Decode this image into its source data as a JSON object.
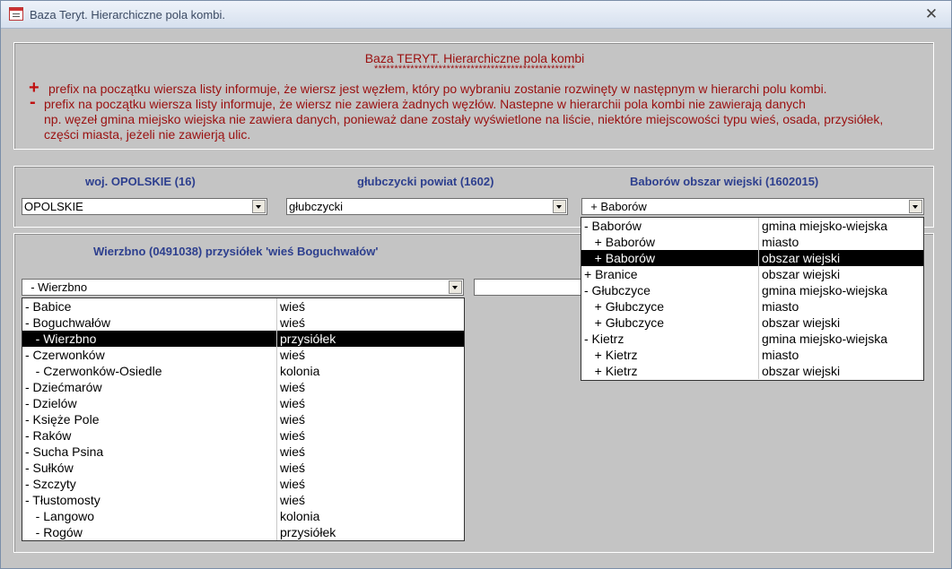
{
  "window": {
    "title": "Baza Teryt. Hierarchiczne pola kombi.",
    "close_glyph": "✕"
  },
  "info": {
    "title": "Baza TERYT. Hierarchiczne pola kombi",
    "stars": "**************************************************",
    "plus_symbol": "+",
    "minus_symbol": "-",
    "line1": "prefix na początku wiersza listy informuje, że wiersz jest węzłem, który po wybraniu zostanie rozwinęty w następnym  w hierarchi polu kombi.",
    "line2": "prefix na początku wiersza listy informuje, że wiersz nie zawiera żadnych węzłów. Nastepne w hierarchii pola kombi nie zawierają danych",
    "line3": "np. węzeł gmina miejsko wiejska nie zawiera danych, ponieważ dane zostały wyświetlone na liście, niektóre miejscowości typu wieś, osada, przysiółek,",
    "line4": "części miasta, jeżeli nie zawierją ulic."
  },
  "headers": {
    "woj": "woj.   OPOLSKIE (16)",
    "powiat": "głubczycki  powiat (1602)",
    "gmina": "Baborów  obszar wiejski (1602015)",
    "miejscowosc": "Wierzbno  (0491038) przysiółek  'wieś Boguchwałów'"
  },
  "combos": {
    "woj": "OPOLSKIE",
    "powiat": "głubczycki",
    "gmina": "  + Baborów",
    "miejscowosc": "  - Wierzbno",
    "extra": ""
  },
  "list_gmina": [
    {
      "name": "- Baborów",
      "type": "gmina miejsko-wiejska",
      "selected": false
    },
    {
      "name": "   + Baborów",
      "type": "miasto",
      "selected": false
    },
    {
      "name": "   + Baborów",
      "type": "obszar wiejski",
      "selected": true
    },
    {
      "name": "+ Branice",
      "type": "obszar wiejski",
      "selected": false
    },
    {
      "name": "- Głubczyce",
      "type": "gmina miejsko-wiejska",
      "selected": false
    },
    {
      "name": "   + Głubczyce",
      "type": "miasto",
      "selected": false
    },
    {
      "name": "   + Głubczyce",
      "type": "obszar wiejski",
      "selected": false
    },
    {
      "name": "- Kietrz",
      "type": "gmina miejsko-wiejska",
      "selected": false
    },
    {
      "name": "   + Kietrz",
      "type": "miasto",
      "selected": false
    },
    {
      "name": "   + Kietrz",
      "type": "obszar wiejski",
      "selected": false
    }
  ],
  "list_miejscowosc": [
    {
      "name": "- Babice",
      "type": "wieś",
      "selected": false
    },
    {
      "name": "- Boguchwałów",
      "type": "wieś",
      "selected": false
    },
    {
      "name": "   - Wierzbno",
      "type": "przysiółek",
      "selected": true
    },
    {
      "name": "- Czerwonków",
      "type": "wieś",
      "selected": false
    },
    {
      "name": "   - Czerwonków-Osiedle",
      "type": "kolonia",
      "selected": false
    },
    {
      "name": "- Dziećmarów",
      "type": "wieś",
      "selected": false
    },
    {
      "name": "- Dzielów",
      "type": "wieś",
      "selected": false
    },
    {
      "name": "- Księże Pole",
      "type": "wieś",
      "selected": false
    },
    {
      "name": "- Raków",
      "type": "wieś",
      "selected": false
    },
    {
      "name": "- Sucha Psina",
      "type": "wieś",
      "selected": false
    },
    {
      "name": "- Sułków",
      "type": "wieś",
      "selected": false
    },
    {
      "name": "- Szczyty",
      "type": "wieś",
      "selected": false
    },
    {
      "name": "- Tłustomosty",
      "type": "wieś",
      "selected": false
    },
    {
      "name": "   - Langowo",
      "type": "kolonia",
      "selected": false
    },
    {
      "name": "   - Rogów",
      "type": "przysiółek",
      "selected": false
    }
  ]
}
